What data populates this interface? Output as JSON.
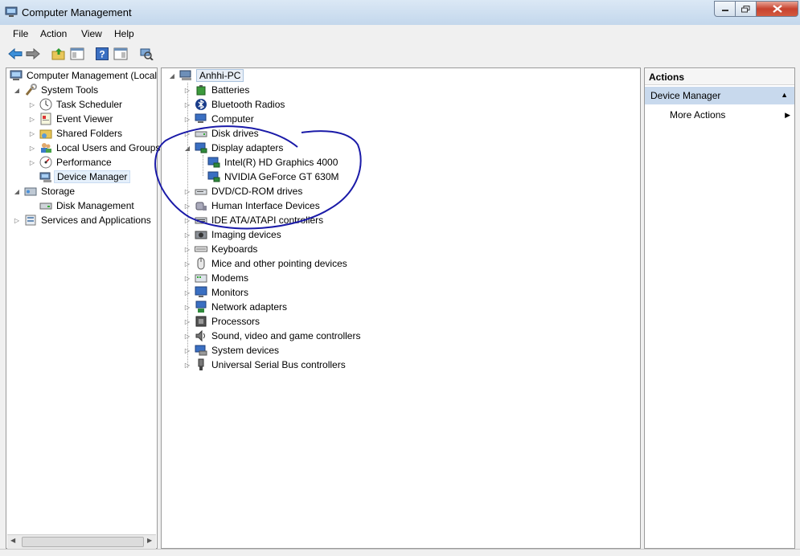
{
  "window": {
    "title": "Computer Management"
  },
  "menu": [
    "File",
    "Action",
    "View",
    "Help"
  ],
  "left_tree": {
    "root": "Computer Management (Local",
    "items": [
      {
        "label": "System Tools",
        "icon": "tools-icon"
      },
      {
        "label": "Task Scheduler",
        "icon": "clock-icon"
      },
      {
        "label": "Event Viewer",
        "icon": "event-viewer-icon"
      },
      {
        "label": "Shared Folders",
        "icon": "shared-folder-icon"
      },
      {
        "label": "Local Users and Groups",
        "icon": "users-icon"
      },
      {
        "label": "Performance",
        "icon": "performance-icon"
      },
      {
        "label": "Device Manager",
        "icon": "device-manager-icon",
        "selected": true
      },
      {
        "label": "Storage",
        "icon": "storage-icon"
      },
      {
        "label": "Disk Management",
        "icon": "disk-icon"
      },
      {
        "label": "Services and Applications",
        "icon": "services-icon"
      }
    ]
  },
  "device_tree": {
    "root": "Anhhi-PC",
    "categories": [
      {
        "label": "Batteries",
        "icon": "battery-icon"
      },
      {
        "label": "Bluetooth Radios",
        "icon": "bluetooth-icon"
      },
      {
        "label": "Computer",
        "icon": "computer-icon"
      },
      {
        "label": "Disk drives",
        "icon": "disk-drive-icon"
      },
      {
        "label": "Display adapters",
        "icon": "display-adapter-icon",
        "expanded": true
      },
      {
        "label": "Intel(R) HD Graphics 4000",
        "icon": "display-adapter-icon"
      },
      {
        "label": "NVIDIA GeForce GT 630M",
        "icon": "display-adapter-icon"
      },
      {
        "label": "DVD/CD-ROM drives",
        "icon": "dvd-icon"
      },
      {
        "label": "Human Interface Devices",
        "icon": "hid-icon"
      },
      {
        "label": "IDE ATA/ATAPI controllers",
        "icon": "ide-icon"
      },
      {
        "label": "Imaging devices",
        "icon": "camera-icon"
      },
      {
        "label": "Keyboards",
        "icon": "keyboard-icon"
      },
      {
        "label": "Mice and other pointing devices",
        "icon": "mouse-icon"
      },
      {
        "label": "Modems",
        "icon": "modem-icon"
      },
      {
        "label": "Monitors",
        "icon": "monitor-icon"
      },
      {
        "label": "Network adapters",
        "icon": "network-icon"
      },
      {
        "label": "Processors",
        "icon": "processor-icon"
      },
      {
        "label": "Sound, video and game controllers",
        "icon": "sound-icon"
      },
      {
        "label": "System devices",
        "icon": "system-devices-icon"
      },
      {
        "label": "Universal Serial Bus controllers",
        "icon": "usb-icon"
      }
    ]
  },
  "actions": {
    "header": "Actions",
    "section": "Device Manager",
    "more": "More Actions"
  },
  "annotation": {
    "color": "#1a1aa8"
  }
}
